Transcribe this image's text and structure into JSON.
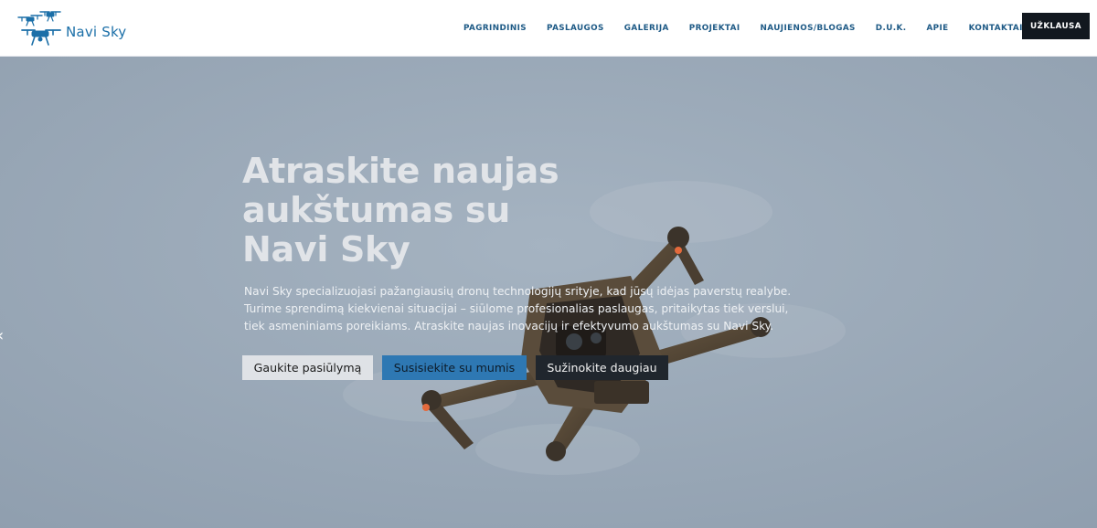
{
  "brand": {
    "name": "Navi Sky",
    "accent": "#1b6fa8"
  },
  "nav": {
    "items": [
      {
        "label": "PAGRINDINIS"
      },
      {
        "label": "PASLAUGOS"
      },
      {
        "label": "GALERIJA"
      },
      {
        "label": "PROJEKTAI"
      },
      {
        "label": "NAUJIENOS/BLOGAS"
      },
      {
        "label": "D.U.K."
      },
      {
        "label": "APIE"
      },
      {
        "label": "KONTAKTAI"
      }
    ],
    "cta_label": "UŽKLAUSA"
  },
  "hero": {
    "title": "Atraskite naujas aukštumas su Navi Sky",
    "description": "Navi Sky specializuojasi pažangiausių dronų technologijų srityje, kad jūsų idėjas paverstų realybe. Turime sprendimą kiekvienai situacijai – siūlome profesionalias paslaugas, pritaikytas tiek verslui, tiek asmeniniams poreikiams. Atraskite naujas inovacijų ir efektyvumo aukštumas su Navi Sky.",
    "buttons": {
      "primary": "Gaukite pasiūlymą",
      "secondary": "Susisiekite su mumis",
      "tertiary": "Sužinokite daugiau"
    },
    "prev_arrow": "‹"
  }
}
